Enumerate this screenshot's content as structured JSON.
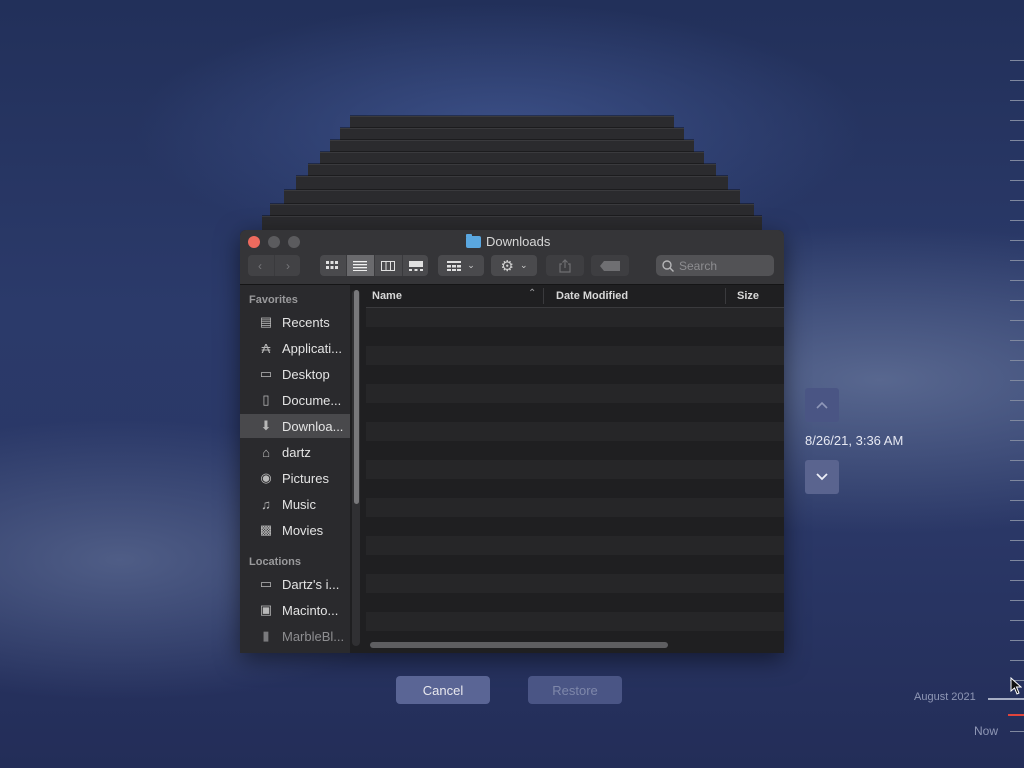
{
  "window": {
    "title": "Downloads",
    "search_placeholder": "Search"
  },
  "sidebar": {
    "favorites_label": "Favorites",
    "favorites": [
      {
        "label": "Recents",
        "icon": "recents-icon"
      },
      {
        "label": "Applicati...",
        "icon": "applications-icon"
      },
      {
        "label": "Desktop",
        "icon": "desktop-icon"
      },
      {
        "label": "Docume...",
        "icon": "documents-icon"
      },
      {
        "label": "Downloa...",
        "icon": "downloads-icon"
      },
      {
        "label": "dartz",
        "icon": "home-icon"
      },
      {
        "label": "Pictures",
        "icon": "pictures-icon"
      },
      {
        "label": "Music",
        "icon": "music-icon"
      },
      {
        "label": "Movies",
        "icon": "movies-icon"
      }
    ],
    "locations_label": "Locations",
    "locations": [
      {
        "label": "Dartz's i...",
        "icon": "computer-icon"
      },
      {
        "label": "Macinto...",
        "icon": "disk-icon"
      },
      {
        "label": "MarbleBl...",
        "icon": "drive-icon"
      }
    ]
  },
  "columns": {
    "name": "Name",
    "date_modified": "Date Modified",
    "size": "Size"
  },
  "timemachine": {
    "snapshot_date": "8/26/21, 3:36 AM",
    "timeline_month": "August 2021",
    "timeline_now": "Now"
  },
  "buttons": {
    "cancel": "Cancel",
    "restore": "Restore"
  },
  "colors": {
    "close": "#ed6a5e",
    "minimize": "#5b5b5e",
    "zoom": "#5b5b5e",
    "accent_folder": "#5aa7e0",
    "timeline_marker": "#e0443c"
  }
}
